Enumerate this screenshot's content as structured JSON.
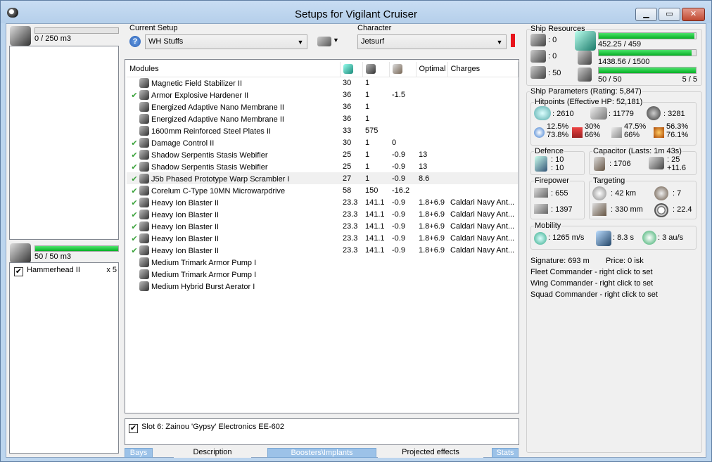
{
  "window": {
    "title": "Setups for Vigilant Cruiser",
    "minimize": "▁",
    "maximize": "▭",
    "close": "✕"
  },
  "cargo": {
    "capacity": "0 / 250 m3",
    "fill": 0
  },
  "drones": {
    "capacity": "50 / 50 m3",
    "fill": 1.0,
    "items": [
      {
        "name": "Hammerhead II",
        "qty": "x 5",
        "checked": true
      }
    ]
  },
  "setup": {
    "label": "Current Setup",
    "value": "WH Stuffs",
    "help": "?"
  },
  "character": {
    "label": "Character",
    "value": "Jetsurf"
  },
  "modules": {
    "columns": [
      "Modules",
      "",
      "",
      "",
      "Optimal",
      "Charges"
    ],
    "rows": [
      {
        "active": false,
        "name": "Magnetic Field Stabilizer II",
        "cpu": "30",
        "pg": "1",
        "cap": "",
        "optimal": "",
        "charges": ""
      },
      {
        "active": true,
        "name": "Armor Explosive Hardener II",
        "cpu": "36",
        "pg": "1",
        "cap": "-1.5",
        "optimal": "",
        "charges": ""
      },
      {
        "active": false,
        "name": "Energized Adaptive Nano Membrane II",
        "cpu": "36",
        "pg": "1",
        "cap": "",
        "optimal": "",
        "charges": ""
      },
      {
        "active": false,
        "name": "Energized Adaptive Nano Membrane II",
        "cpu": "36",
        "pg": "1",
        "cap": "",
        "optimal": "",
        "charges": ""
      },
      {
        "active": false,
        "name": "1600mm Reinforced Steel Plates II",
        "cpu": "33",
        "pg": "575",
        "cap": "",
        "optimal": "",
        "charges": ""
      },
      {
        "active": true,
        "name": "Damage Control II",
        "cpu": "30",
        "pg": "1",
        "cap": "0",
        "optimal": "",
        "charges": ""
      },
      {
        "active": true,
        "name": "Shadow Serpentis Stasis Webifier",
        "cpu": "25",
        "pg": "1",
        "cap": "-0.9",
        "optimal": "13",
        "charges": ""
      },
      {
        "active": true,
        "name": "Shadow Serpentis Stasis Webifier",
        "cpu": "25",
        "pg": "1",
        "cap": "-0.9",
        "optimal": "13",
        "charges": ""
      },
      {
        "active": true,
        "name": "J5b Phased Prototype Warp Scrambler I",
        "cpu": "27",
        "pg": "1",
        "cap": "-0.9",
        "optimal": "8.6",
        "charges": ""
      },
      {
        "active": true,
        "name": "Corelum C-Type 10MN Microwarpdrive",
        "cpu": "58",
        "pg": "150",
        "cap": "-16.2",
        "optimal": "",
        "charges": ""
      },
      {
        "active": true,
        "name": "Heavy Ion Blaster II",
        "cpu": "23.3",
        "pg": "141.1",
        "cap": "-0.9",
        "optimal": "1.8+6.9",
        "charges": "Caldari Navy Ant..."
      },
      {
        "active": true,
        "name": "Heavy Ion Blaster II",
        "cpu": "23.3",
        "pg": "141.1",
        "cap": "-0.9",
        "optimal": "1.8+6.9",
        "charges": "Caldari Navy Ant..."
      },
      {
        "active": true,
        "name": "Heavy Ion Blaster II",
        "cpu": "23.3",
        "pg": "141.1",
        "cap": "-0.9",
        "optimal": "1.8+6.9",
        "charges": "Caldari Navy Ant..."
      },
      {
        "active": true,
        "name": "Heavy Ion Blaster II",
        "cpu": "23.3",
        "pg": "141.1",
        "cap": "-0.9",
        "optimal": "1.8+6.9",
        "charges": "Caldari Navy Ant..."
      },
      {
        "active": true,
        "name": "Heavy Ion Blaster II",
        "cpu": "23.3",
        "pg": "141.1",
        "cap": "-0.9",
        "optimal": "1.8+6.9",
        "charges": "Caldari Navy Ant..."
      },
      {
        "active": false,
        "name": "Medium Trimark Armor Pump I",
        "cpu": "",
        "pg": "",
        "cap": "",
        "optimal": "",
        "charges": ""
      },
      {
        "active": false,
        "name": "Medium Trimark Armor Pump I",
        "cpu": "",
        "pg": "",
        "cap": "",
        "optimal": "",
        "charges": ""
      },
      {
        "active": false,
        "name": "Medium Hybrid Burst Aerator I",
        "cpu": "",
        "pg": "",
        "cap": "",
        "optimal": "",
        "charges": ""
      }
    ]
  },
  "implant": {
    "text": "Slot 6: Zainou 'Gypsy' Electronics EE-602",
    "checked": true
  },
  "tabs": [
    "Bays",
    "Description",
    "Boosters\\Implants",
    "Projected effects",
    "Stats"
  ],
  "resources": {
    "title": "Ship Resources",
    "hardpoints": [
      ": 0",
      ": 0",
      ": 50"
    ],
    "cpu": {
      "text": "452.25 / 459",
      "fill": 0.985
    },
    "powergrid": {
      "text": "1438.56 / 1500",
      "fill": 0.959
    },
    "drone_bw": {
      "text": "50 / 50",
      "fill": 1.0
    },
    "drones_active": "5 / 5"
  },
  "params": {
    "title": "Ship Parameters (Rating: 5,847)",
    "hitpoints": {
      "title": "Hitpoints (Effective HP: 52,181)",
      "shield": ": 2610",
      "armor": ": 11779",
      "structure": ": 3281",
      "res": [
        "12.5%",
        "73.8%",
        "30%",
        "66%",
        "47.5%",
        "66%",
        "56.3%",
        "76.1%"
      ]
    },
    "defence": {
      "title": "Defence",
      "a": ": 10",
      "b": ": 10"
    },
    "capacitor": {
      "title": "Capacitor (Lasts: 1m 43s)",
      "amount": ": 1706",
      "a": ": 25",
      "b": "+11.6"
    },
    "firepower": {
      "title": "Firepower",
      "dps": ": 655",
      "volley": ": 1397"
    },
    "targeting": {
      "title": "Targeting",
      "range": ": 42 km",
      "targets": ": 7",
      "res": ": 330 mm",
      "scan": ": 22.4"
    },
    "mobility": {
      "title": "Mobility",
      "speed": ": 1265 m/s",
      "align": ": 8.3 s",
      "warp": ": 3 au/s"
    },
    "signature": "Signature: 693 m",
    "price": "Price: 0 isk",
    "fleet": "Fleet Commander - right click to set",
    "wing": "Wing Commander - right click to set",
    "squad": "Squad Commander - right click to set"
  }
}
